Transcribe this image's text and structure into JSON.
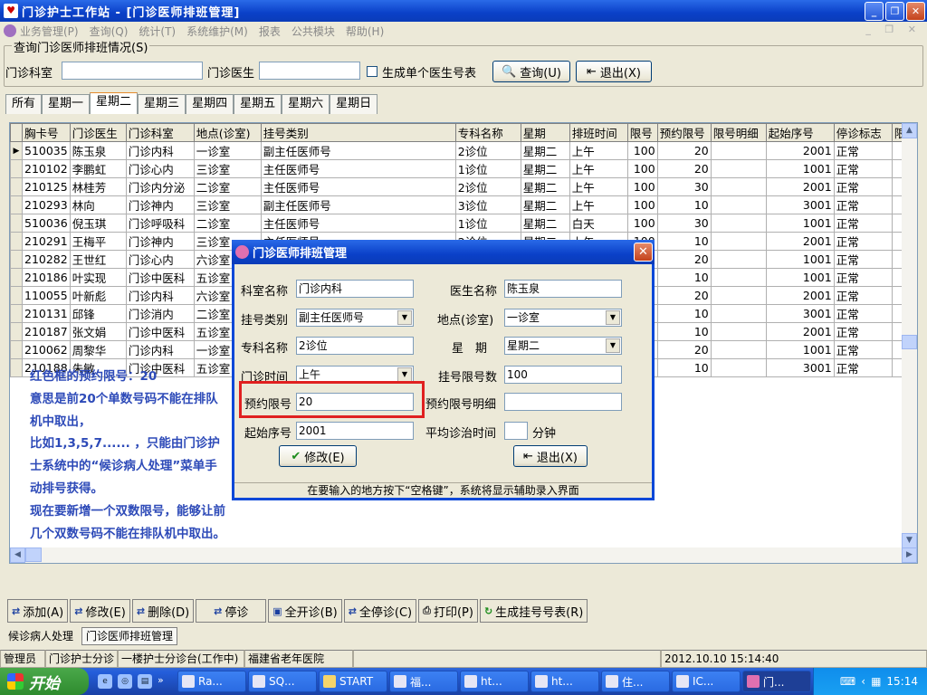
{
  "window": {
    "title": "门诊护士工作站 - [门诊医师排班管理]"
  },
  "menu": [
    "业务管理(P)",
    "查询(Q)",
    "统计(T)",
    "系统维护(M)",
    "报表",
    "公共模块",
    "帮助(H)"
  ],
  "query": {
    "group_title": "查询门诊医师排班情况(S)",
    "dept_label": "门诊科室",
    "dept_value": "",
    "doctor_label": "门诊医生",
    "doctor_value": "",
    "checkbox_label": "生成单个医生号表",
    "query_btn": "查询(U)",
    "exit_btn": "退出(X)"
  },
  "tabs": [
    "所有",
    "星期一",
    "星期二",
    "星期三",
    "星期四",
    "星期五",
    "星期六",
    "星期日"
  ],
  "active_tab": "星期二",
  "grid": {
    "columns": [
      "胸卡号",
      "门诊医生",
      "门诊科室",
      "地点(诊室)",
      "挂号类别",
      "专科名称",
      "星期",
      "排班时间",
      "限号",
      "预约限号",
      "限号明细",
      "起始序号",
      "停诊标志",
      "限"
    ],
    "rows": [
      [
        "510035",
        "陈玉泉",
        "门诊内科",
        "一诊室",
        "副主任医师号",
        "2诊位",
        "星期二",
        "上午",
        "100",
        "20",
        "",
        "2001",
        "正常"
      ],
      [
        "210102",
        "李鹏虹",
        "门诊心内",
        "三诊室",
        "主任医师号",
        "1诊位",
        "星期二",
        "上午",
        "100",
        "20",
        "",
        "1001",
        "正常"
      ],
      [
        "210125",
        "林桂芳",
        "门诊内分泌",
        "二诊室",
        "主任医师号",
        "2诊位",
        "星期二",
        "上午",
        "100",
        "30",
        "",
        "2001",
        "正常"
      ],
      [
        "210293",
        "林向",
        "门诊神内",
        "三诊室",
        "副主任医师号",
        "3诊位",
        "星期二",
        "上午",
        "100",
        "10",
        "",
        "3001",
        "正常"
      ],
      [
        "510036",
        "倪玉琪",
        "门诊呼吸科",
        "二诊室",
        "主任医师号",
        "1诊位",
        "星期二",
        "白天",
        "100",
        "30",
        "",
        "1001",
        "正常"
      ],
      [
        "210291",
        "王梅平",
        "门诊神内",
        "三诊室",
        "主任医师号",
        "2诊位",
        "星期二",
        "上午",
        "100",
        "10",
        "",
        "2001",
        "正常"
      ],
      [
        "210282",
        "王世红",
        "门诊心内",
        "六诊室",
        "",
        "",
        "",
        "",
        "",
        "20",
        "",
        "1001",
        "正常"
      ],
      [
        "210186",
        "叶实现",
        "门诊中医科",
        "五诊室",
        "",
        "",
        "",
        "",
        "",
        "10",
        "",
        "1001",
        "正常"
      ],
      [
        "110055",
        "叶新彪",
        "门诊内科",
        "六诊室",
        "",
        "",
        "",
        "",
        "",
        "20",
        "",
        "2001",
        "正常"
      ],
      [
        "210131",
        "邱锋",
        "门诊消内",
        "二诊室",
        "",
        "",
        "",
        "",
        "",
        "10",
        "",
        "3001",
        "正常"
      ],
      [
        "210187",
        "张文娟",
        "门诊中医科",
        "五诊室",
        "",
        "",
        "",
        "",
        "",
        "10",
        "",
        "2001",
        "正常"
      ],
      [
        "210062",
        "周黎华",
        "门诊内科",
        "一诊室",
        "",
        "",
        "",
        "",
        "",
        "20",
        "",
        "1001",
        "正常"
      ],
      [
        "210188",
        "朱敏",
        "门诊中医科",
        "五诊室",
        "",
        "",
        "",
        "",
        "",
        "10",
        "",
        "3001",
        "正常"
      ]
    ]
  },
  "annotation": [
    "红色框的预约限号：20",
    "意思是前20个单数号码不能在排队机中取出，",
    "比如1,3,5,7...... ，只能由门诊护士系统中的“候诊病人处理”菜单手动排号获得。",
    "现在要新增一个双数限号，能够让前几个双数号码不能在排队机中取出。"
  ],
  "dialog": {
    "title": "门诊医师排班管理",
    "dept_label": "科室名称",
    "dept_value": "门诊内科",
    "doctor_label": "医生名称",
    "doctor_value": "陈玉泉",
    "reg_type_label": "挂号类别",
    "reg_type_value": "副主任医师号",
    "location_label": "地点(诊室)",
    "location_value": "一诊室",
    "specialty_label": "专科名称",
    "specialty_value": "2诊位",
    "weekday_label": "星　期",
    "weekday_value": "星期二",
    "time_label": "门诊时间",
    "time_value": "上午",
    "limit_label": "挂号限号数",
    "limit_value": "100",
    "appt_limit_label": "预约限号",
    "appt_limit_value": "20",
    "appt_detail_label": "预约限号明细",
    "appt_detail_value": "",
    "start_label": "起始序号",
    "start_value": "2001",
    "avg_time_label": "平均诊治时间",
    "avg_time_value": "",
    "avg_time_unit": "分钟",
    "modify_btn": "修改(E)",
    "exit_btn": "退出(X)",
    "status": "在要输入的地方按下“空格键”，系统将显示辅助录入界面",
    "highlight_color": "#e02020"
  },
  "toolbar": [
    "添加(A)",
    "修改(E)",
    "删除(D)",
    "停诊",
    "全开诊(B)",
    "全停诊(C)",
    "打印(P)",
    "生成挂号号表(R)"
  ],
  "mdi_tabs": [
    "候诊病人处理",
    "门诊医师排班管理"
  ],
  "status": [
    "管理员",
    "门诊护士分诊",
    "一楼护士分诊台(工作中)",
    "福建省老年医院",
    "",
    "2012.10.10 15:14:40"
  ],
  "taskbar": {
    "start": "开始",
    "items": [
      "Ra...",
      "SQ...",
      "START",
      "福...",
      "ht...",
      "ht...",
      "住...",
      "IC...",
      "门..."
    ],
    "clock": "15:14"
  }
}
